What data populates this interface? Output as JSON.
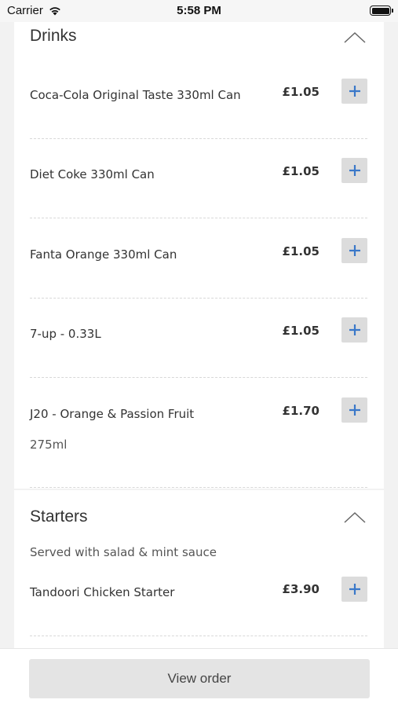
{
  "status_bar": {
    "carrier": "Carrier",
    "time": "5:58 PM"
  },
  "sections": {
    "drinks": {
      "title": "Drinks",
      "items": [
        {
          "name": "Coca-Cola Original Taste 330ml Can",
          "price": "£1.05"
        },
        {
          "name": "Diet Coke 330ml Can",
          "price": "£1.05"
        },
        {
          "name": "Fanta Orange 330ml Can",
          "price": "£1.05"
        },
        {
          "name": "7-up - 0.33L",
          "price": "£1.05"
        },
        {
          "name": "J20 - Orange & Passion Fruit",
          "price": "£1.70",
          "description": "275ml"
        }
      ]
    },
    "starters": {
      "title": "Starters",
      "subtitle": "Served with salad & mint sauce",
      "items": [
        {
          "name": "Tandoori Chicken Starter",
          "price": "£3.90"
        }
      ]
    }
  },
  "footer": {
    "view_order_label": "View order"
  },
  "colors": {
    "accent_plus": "#3a78c9",
    "button_bg": "#dcdcdc",
    "card_bg": "#ffffff",
    "page_bg": "#f2f2f2"
  },
  "icons": [
    "wifi-icon",
    "battery-icon",
    "chevron-up-icon",
    "plus-icon"
  ]
}
